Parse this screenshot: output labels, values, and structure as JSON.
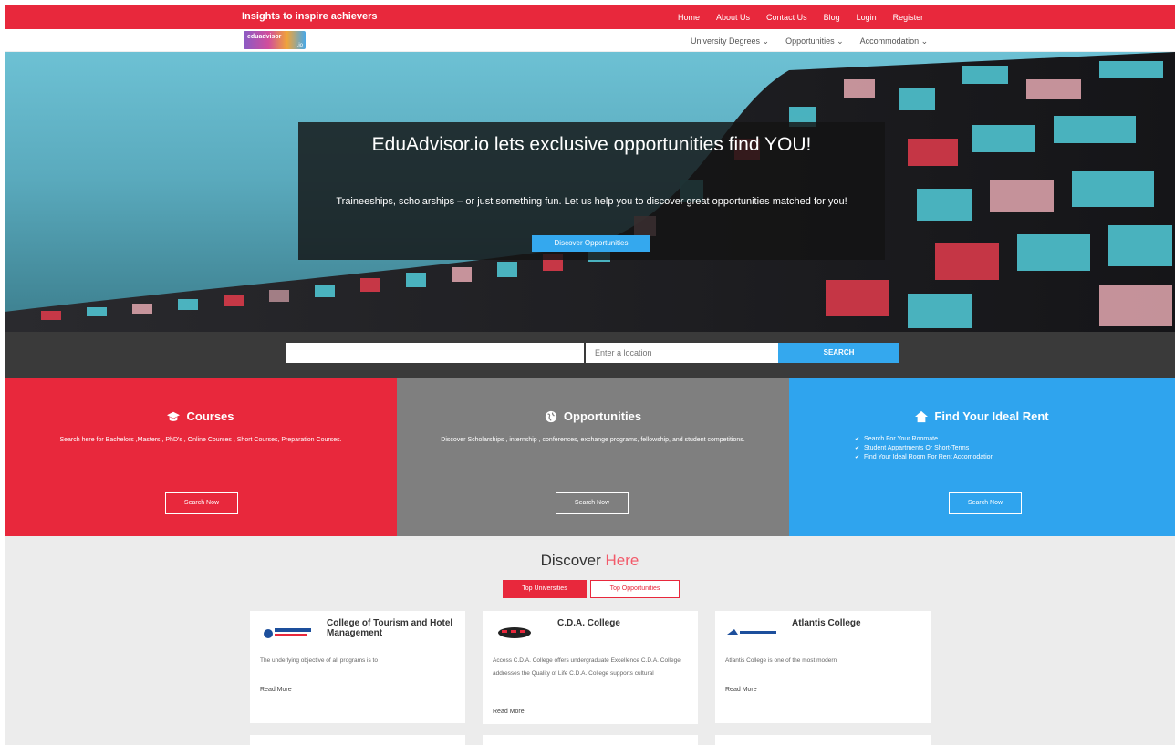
{
  "topbar": {
    "tagline": "Insights to inspire achievers",
    "links": [
      "Home",
      "About Us",
      "Contact Us",
      "Blog",
      "Login",
      "Register"
    ]
  },
  "logo": {
    "text": "eduadvisor",
    "suffix": ".io"
  },
  "nav": {
    "items": [
      "University Degrees ⌄",
      "Opportunities ⌄",
      "Accommodation ⌄"
    ]
  },
  "hero": {
    "title": "EduAdvisor.io lets exclusive opportunities find YOU!",
    "subtitle": "Traineeships, scholarships – or just something fun. Let us help you to discover great opportunities matched for you!",
    "button": "Discover Opportunities"
  },
  "search": {
    "query_value": "",
    "location_placeholder": "Enter a location",
    "button": "SEARCH"
  },
  "panels": {
    "courses": {
      "icon": "graduation-cap-icon",
      "title": "Courses",
      "description": "Search here for Bachelors ,Masters , PhD's , Online Courses , Short Courses, Preparation Courses.",
      "button": "Search Now"
    },
    "opportunities": {
      "icon": "globe-icon",
      "title": "Opportunities",
      "description": "Discover Scholarships , internship , conferences, exchange programs, fellowship, and student competitions.",
      "button": "Search Now"
    },
    "rent": {
      "icon": "home-icon",
      "title": "Find Your Ideal Rent",
      "list": [
        "Search For Your Roomate",
        "Student Appartments Or Short-Terms",
        "Find Your Ideal Room For Rent Accomodation"
      ],
      "button": "Search Now"
    }
  },
  "discover": {
    "heading_main": "Discover",
    "heading_accent": "Here",
    "tabs": [
      "Top Universities",
      "Top Opportunities"
    ],
    "cards": [
      {
        "title": "College of Tourism and Hotel Management",
        "text": "The underlying objective of all programs is to",
        "link": "Read More"
      },
      {
        "title": "C.D.A. College",
        "text": "Access C.D.A. College offers undergraduate Excellence C.D.A. College addresses the Quality of Life C.D.A. College supports cultural",
        "link": "Read More"
      },
      {
        "title": "Atlantis College",
        "text": "Atlantis College is one of the most modern",
        "link": "Read More"
      }
    ]
  },
  "colors": {
    "brand_red": "#e8283c",
    "grey": "#7f7f7f",
    "blue": "#2fa4ee",
    "dark": "#3a3a3a"
  }
}
